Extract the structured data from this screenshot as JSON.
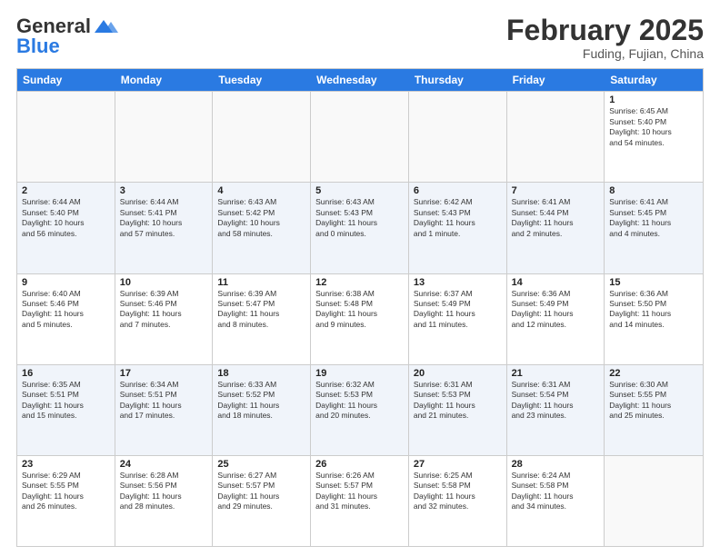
{
  "logo": {
    "general": "General",
    "blue": "Blue"
  },
  "title": "February 2025",
  "location": "Fuding, Fujian, China",
  "days_of_week": [
    "Sunday",
    "Monday",
    "Tuesday",
    "Wednesday",
    "Thursday",
    "Friday",
    "Saturday"
  ],
  "weeks": [
    [
      {
        "day": "",
        "info": ""
      },
      {
        "day": "",
        "info": ""
      },
      {
        "day": "",
        "info": ""
      },
      {
        "day": "",
        "info": ""
      },
      {
        "day": "",
        "info": ""
      },
      {
        "day": "",
        "info": ""
      },
      {
        "day": "1",
        "info": "Sunrise: 6:45 AM\nSunset: 5:40 PM\nDaylight: 10 hours\nand 54 minutes."
      }
    ],
    [
      {
        "day": "2",
        "info": "Sunrise: 6:44 AM\nSunset: 5:40 PM\nDaylight: 10 hours\nand 56 minutes."
      },
      {
        "day": "3",
        "info": "Sunrise: 6:44 AM\nSunset: 5:41 PM\nDaylight: 10 hours\nand 57 minutes."
      },
      {
        "day": "4",
        "info": "Sunrise: 6:43 AM\nSunset: 5:42 PM\nDaylight: 10 hours\nand 58 minutes."
      },
      {
        "day": "5",
        "info": "Sunrise: 6:43 AM\nSunset: 5:43 PM\nDaylight: 11 hours\nand 0 minutes."
      },
      {
        "day": "6",
        "info": "Sunrise: 6:42 AM\nSunset: 5:43 PM\nDaylight: 11 hours\nand 1 minute."
      },
      {
        "day": "7",
        "info": "Sunrise: 6:41 AM\nSunset: 5:44 PM\nDaylight: 11 hours\nand 2 minutes."
      },
      {
        "day": "8",
        "info": "Sunrise: 6:41 AM\nSunset: 5:45 PM\nDaylight: 11 hours\nand 4 minutes."
      }
    ],
    [
      {
        "day": "9",
        "info": "Sunrise: 6:40 AM\nSunset: 5:46 PM\nDaylight: 11 hours\nand 5 minutes."
      },
      {
        "day": "10",
        "info": "Sunrise: 6:39 AM\nSunset: 5:46 PM\nDaylight: 11 hours\nand 7 minutes."
      },
      {
        "day": "11",
        "info": "Sunrise: 6:39 AM\nSunset: 5:47 PM\nDaylight: 11 hours\nand 8 minutes."
      },
      {
        "day": "12",
        "info": "Sunrise: 6:38 AM\nSunset: 5:48 PM\nDaylight: 11 hours\nand 9 minutes."
      },
      {
        "day": "13",
        "info": "Sunrise: 6:37 AM\nSunset: 5:49 PM\nDaylight: 11 hours\nand 11 minutes."
      },
      {
        "day": "14",
        "info": "Sunrise: 6:36 AM\nSunset: 5:49 PM\nDaylight: 11 hours\nand 12 minutes."
      },
      {
        "day": "15",
        "info": "Sunrise: 6:36 AM\nSunset: 5:50 PM\nDaylight: 11 hours\nand 14 minutes."
      }
    ],
    [
      {
        "day": "16",
        "info": "Sunrise: 6:35 AM\nSunset: 5:51 PM\nDaylight: 11 hours\nand 15 minutes."
      },
      {
        "day": "17",
        "info": "Sunrise: 6:34 AM\nSunset: 5:51 PM\nDaylight: 11 hours\nand 17 minutes."
      },
      {
        "day": "18",
        "info": "Sunrise: 6:33 AM\nSunset: 5:52 PM\nDaylight: 11 hours\nand 18 minutes."
      },
      {
        "day": "19",
        "info": "Sunrise: 6:32 AM\nSunset: 5:53 PM\nDaylight: 11 hours\nand 20 minutes."
      },
      {
        "day": "20",
        "info": "Sunrise: 6:31 AM\nSunset: 5:53 PM\nDaylight: 11 hours\nand 21 minutes."
      },
      {
        "day": "21",
        "info": "Sunrise: 6:31 AM\nSunset: 5:54 PM\nDaylight: 11 hours\nand 23 minutes."
      },
      {
        "day": "22",
        "info": "Sunrise: 6:30 AM\nSunset: 5:55 PM\nDaylight: 11 hours\nand 25 minutes."
      }
    ],
    [
      {
        "day": "23",
        "info": "Sunrise: 6:29 AM\nSunset: 5:55 PM\nDaylight: 11 hours\nand 26 minutes."
      },
      {
        "day": "24",
        "info": "Sunrise: 6:28 AM\nSunset: 5:56 PM\nDaylight: 11 hours\nand 28 minutes."
      },
      {
        "day": "25",
        "info": "Sunrise: 6:27 AM\nSunset: 5:57 PM\nDaylight: 11 hours\nand 29 minutes."
      },
      {
        "day": "26",
        "info": "Sunrise: 6:26 AM\nSunset: 5:57 PM\nDaylight: 11 hours\nand 31 minutes."
      },
      {
        "day": "27",
        "info": "Sunrise: 6:25 AM\nSunset: 5:58 PM\nDaylight: 11 hours\nand 32 minutes."
      },
      {
        "day": "28",
        "info": "Sunrise: 6:24 AM\nSunset: 5:58 PM\nDaylight: 11 hours\nand 34 minutes."
      },
      {
        "day": "",
        "info": ""
      }
    ]
  ]
}
